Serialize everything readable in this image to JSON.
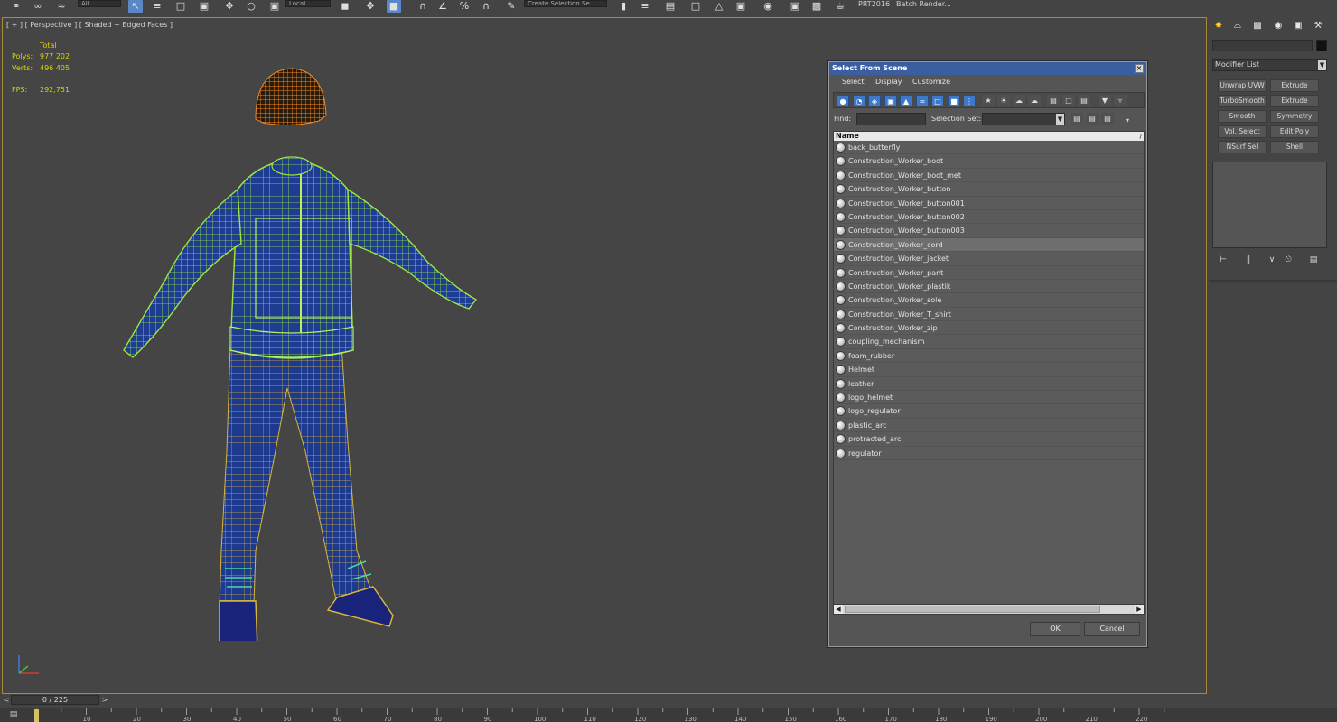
{
  "toolbar": {
    "selection_filter": "All",
    "coordinate_system": "Local",
    "named_selection_placeholder": "Create Selection Se",
    "project_label": "PRT2016",
    "batch_render_label": "Batch Render..."
  },
  "viewport": {
    "label": "[ + ] [ Perspective ] [ Shaded + Edged Faces ]",
    "stats": {
      "total_label": "Total",
      "polys_label": "Polys:",
      "polys_value": "977 202",
      "verts_label": "Verts:",
      "verts_value": "496 405",
      "fps_label": "FPS:",
      "fps_value": "292,751"
    },
    "accent_color": "#d6d400",
    "border_color": "#a98a3a"
  },
  "dialog": {
    "title": "Select From Scene",
    "menu": [
      "Select",
      "Display",
      "Customize"
    ],
    "find_label": "Find:",
    "find_value": "",
    "selection_set_label": "Selection Set:",
    "selection_set_value": "",
    "list_header": "Name",
    "selected_index": 7,
    "items": [
      "back_butterfly",
      "Construction_Worker_boot",
      "Construction_Worker_boot_met",
      "Construction_Worker_button",
      "Construction_Worker_button001",
      "Construction_Worker_button002",
      "Construction_Worker_button003",
      "Construction_Worker_cord",
      "Construction_Worker_jacket",
      "Construction_Worker_pant",
      "Construction_Worker_plastik",
      "Construction_Worker_sole",
      "Construction_Worker_T_shirt",
      "Construction_Worker_zip",
      "coupling_mechanism",
      "foam_rubber",
      "Helmet",
      "leather",
      "logo_helmet",
      "logo_regulator",
      "plastic_arc",
      "protracted_arc",
      "regulator"
    ],
    "ok_label": "OK",
    "cancel_label": "Cancel",
    "title_color": "#3a5ea0"
  },
  "command_panel": {
    "modifier_list_label": "Modifier List",
    "modifier_buttons": [
      [
        "Unwrap UVW",
        "Extrude"
      ],
      [
        "TurboSmooth",
        "Extrude"
      ],
      [
        "Smooth",
        "Symmetry"
      ],
      [
        "Vol. Select",
        "Edit Poly"
      ],
      [
        "NSurf Sel",
        "Shell"
      ]
    ]
  },
  "timeline": {
    "frame_display": "0 / 225",
    "ruler_ticks": [
      "10",
      "20",
      "30",
      "40",
      "50",
      "60",
      "70",
      "80",
      "90",
      "100",
      "110",
      "120",
      "130",
      "140",
      "150",
      "160",
      "170",
      "180",
      "190",
      "200",
      "210",
      "220"
    ]
  }
}
